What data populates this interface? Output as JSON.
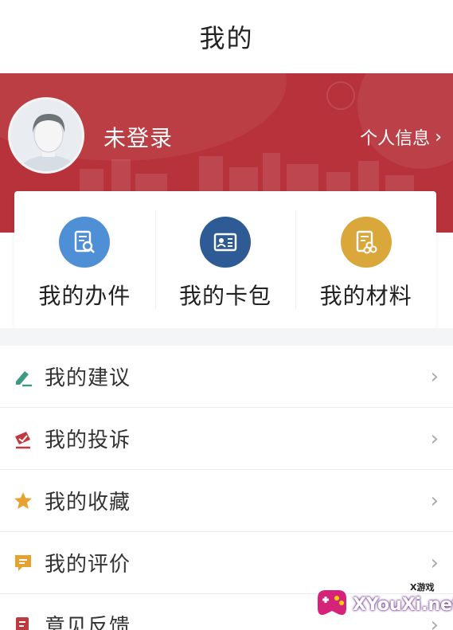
{
  "header": {
    "title": "我的"
  },
  "profile": {
    "login_status": "未登录",
    "info_link": "个人信息"
  },
  "quick_actions": [
    {
      "label": "我的办件",
      "icon": "document-search-icon",
      "color": "#4f8fd6"
    },
    {
      "label": "我的卡包",
      "icon": "id-card-icon",
      "color": "#2e5a96"
    },
    {
      "label": "我的材料",
      "icon": "materials-icon",
      "color": "#d9a73a"
    }
  ],
  "menu": [
    {
      "label": "我的建议",
      "icon": "pencil-icon",
      "color": "#3d9a82"
    },
    {
      "label": "我的投诉",
      "icon": "complaint-icon",
      "color": "#c0393f"
    },
    {
      "label": "我的收藏",
      "icon": "star-icon",
      "color": "#e6a12e"
    },
    {
      "label": "我的评价",
      "icon": "comment-icon",
      "color": "#e6a12e"
    },
    {
      "label": "意见反馈",
      "icon": "feedback-icon",
      "color": "#c0393f"
    }
  ],
  "colors": {
    "banner": "#b7323a",
    "page_gap": "#f4f5f7"
  },
  "watermark": {
    "logo": "XYouXi.net",
    "tagline": "X游戏"
  }
}
